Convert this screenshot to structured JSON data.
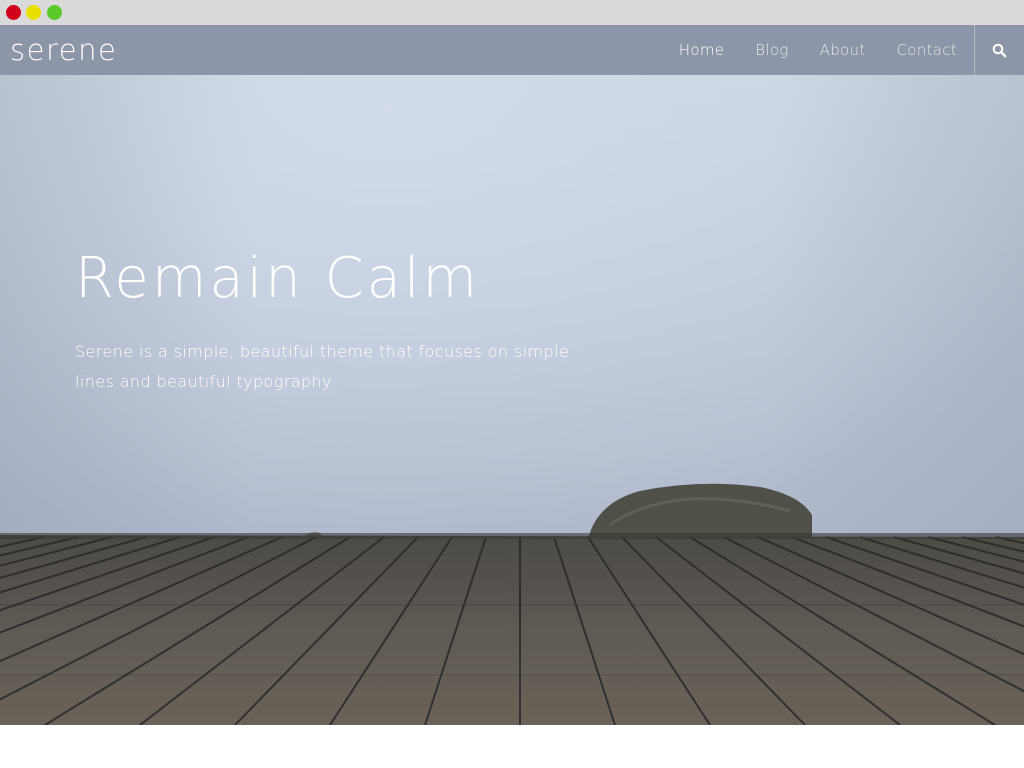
{
  "window": {
    "controls": [
      {
        "name": "close",
        "color": "#d0021b"
      },
      {
        "name": "minimize",
        "color": "#e8e000"
      },
      {
        "name": "maximize",
        "color": "#5cc92a"
      }
    ]
  },
  "nav": {
    "brand": "serene",
    "links": [
      {
        "label": "Home",
        "active": true
      },
      {
        "label": "Blog",
        "active": false
      },
      {
        "label": "About",
        "active": false
      },
      {
        "label": "Contact",
        "active": false
      }
    ],
    "search_icon": "search-icon"
  },
  "hero": {
    "title": "Remain Calm",
    "subtitle": "Serene is a simple, beautiful theme that focuses on simple lines and beautiful typography."
  },
  "colors": {
    "navbar": "#8c96a8",
    "sky_top": "#c9d4e3",
    "sky_bottom": "#a4aec2",
    "deck": "#5a5650",
    "text": "#ffffff"
  }
}
